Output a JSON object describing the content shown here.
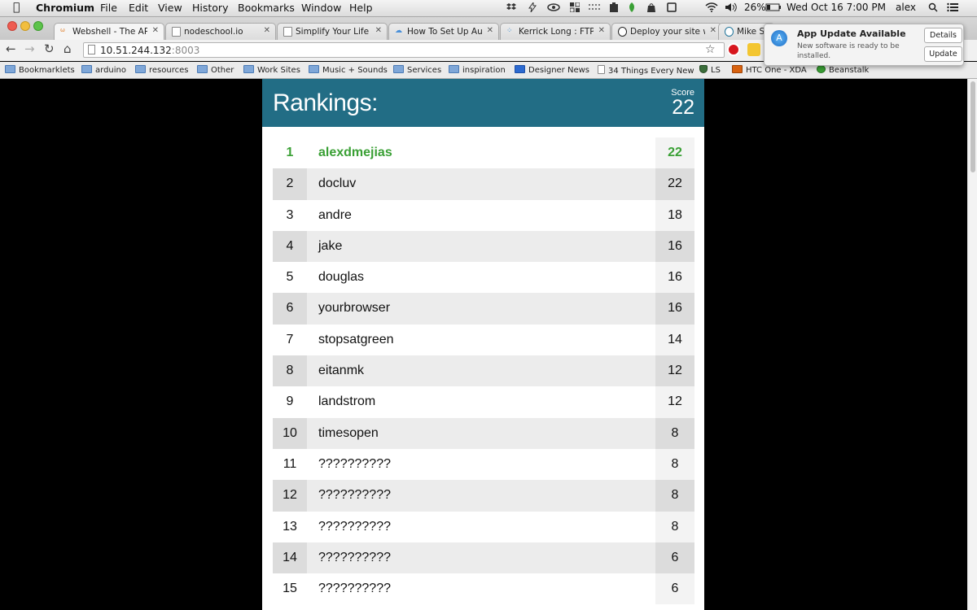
{
  "menubar": {
    "app": "Chromium",
    "items": [
      "File",
      "Edit",
      "View",
      "History",
      "Bookmarks",
      "Window",
      "Help"
    ],
    "battery": "26%",
    "clock": "Wed Oct 16  7:00 PM",
    "user": "alex"
  },
  "tabs": [
    {
      "title": "Webshell - The API C"
    },
    {
      "title": "nodeschool.io"
    },
    {
      "title": "Simplify Your Life W"
    },
    {
      "title": "How To Set Up Auto"
    },
    {
      "title": "Kerrick Long : FTP is"
    },
    {
      "title": "Deploy your site wit"
    },
    {
      "title": "Mike Sch"
    }
  ],
  "address": {
    "host": "10.51.244.132",
    "port": ":8003"
  },
  "bookmarks": [
    "Bookmarklets",
    "arduino",
    "resources",
    "Other",
    "Work Sites",
    "Music + Sounds",
    "Services",
    "inspiration",
    "Designer News",
    "34 Things Every New",
    "LS",
    "HTC One - XDA",
    "Beanstalk"
  ],
  "notification": {
    "title": "App Update Available",
    "body": "New software is ready to be installed.",
    "details_label": "Details",
    "update_label": "Update"
  },
  "rankings": {
    "title": "Rankings:",
    "score_label": "Score",
    "score_value": "22",
    "colors": {
      "header": "#226d85",
      "leader": "#3aa035"
    },
    "rows": [
      {
        "rank": "1",
        "name": "alexdmejias",
        "score": "22"
      },
      {
        "rank": "2",
        "name": "docluv",
        "score": "22"
      },
      {
        "rank": "3",
        "name": "andre",
        "score": "18"
      },
      {
        "rank": "4",
        "name": "jake",
        "score": "16"
      },
      {
        "rank": "5",
        "name": "douglas",
        "score": "16"
      },
      {
        "rank": "6",
        "name": "yourbrowser",
        "score": "16"
      },
      {
        "rank": "7",
        "name": "stopsatgreen",
        "score": "14"
      },
      {
        "rank": "8",
        "name": "eitanmk",
        "score": "12"
      },
      {
        "rank": "9",
        "name": "landstrom",
        "score": "12"
      },
      {
        "rank": "10",
        "name": "timesopen",
        "score": "8"
      },
      {
        "rank": "11",
        "name": "??????????",
        "score": "8"
      },
      {
        "rank": "12",
        "name": "??????????",
        "score": "8"
      },
      {
        "rank": "13",
        "name": "??????????",
        "score": "8"
      },
      {
        "rank": "14",
        "name": "??????????",
        "score": "6"
      },
      {
        "rank": "15",
        "name": "??????????",
        "score": "6"
      }
    ]
  }
}
